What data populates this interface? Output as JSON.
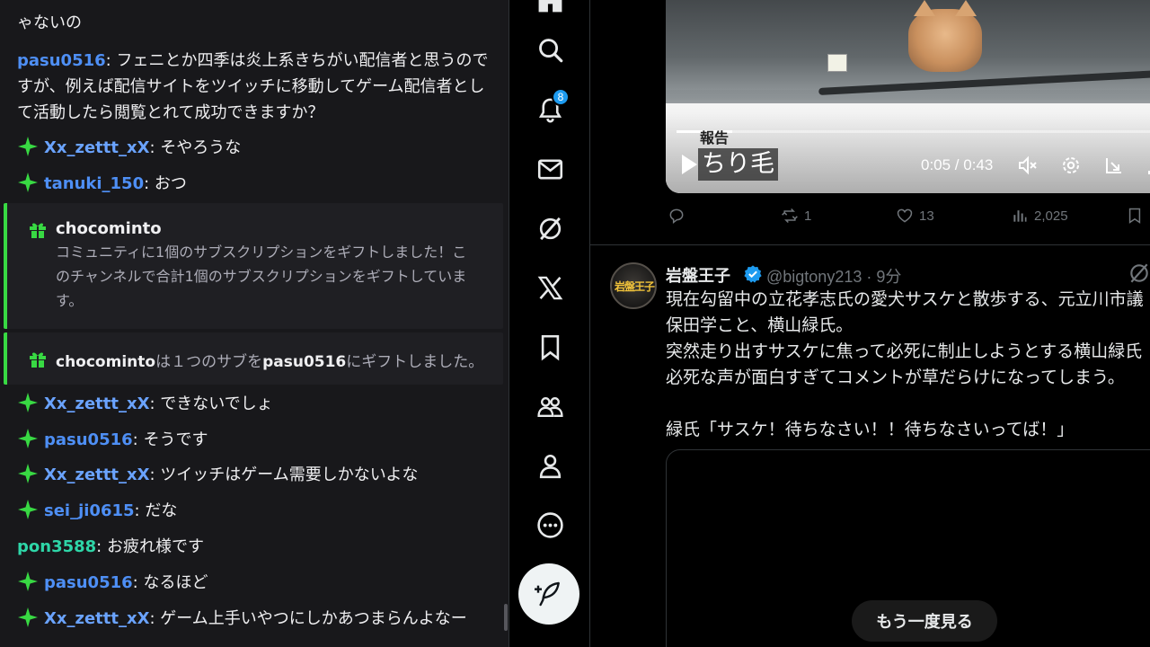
{
  "chat": {
    "partial_top": "ゃないの",
    "messages": [
      {
        "user": "pasu0516",
        "text": "フェニとか四季は炎上系きちがい配信者と思うのですが、例えば配信サイトをツイッチに移動してゲーム配信者として活動したら閲覧とれて成功できますか？",
        "badge": false,
        "color": "u-blue"
      },
      {
        "user": "Xx_zettt_xX",
        "text": "そやろうな",
        "badge": true,
        "color": "u-lblue"
      },
      {
        "user": "tanuki_150",
        "text": "おつ",
        "badge": true,
        "color": "u-blue"
      },
      {
        "user": "Xx_zettt_xX",
        "text": "できないでしょ",
        "badge": true,
        "color": "u-lblue"
      },
      {
        "user": "pasu0516",
        "text": "そうです",
        "badge": true,
        "color": "u-blue"
      },
      {
        "user": "Xx_zettt_xX",
        "text": "ツイッチはゲーム需要しかないよな",
        "badge": true,
        "color": "u-lblue"
      },
      {
        "user": "sei_ji0615",
        "text": "だな",
        "badge": true,
        "color": "u-blue"
      },
      {
        "user": "pon3588",
        "text": "お疲れ様です",
        "badge": false,
        "color": "u-teal"
      },
      {
        "user": "pasu0516",
        "text": "なるほど",
        "badge": true,
        "color": "u-blue"
      },
      {
        "user": "Xx_zettt_xX",
        "text": "ゲーム上手いやつにしかあつまらんよなー",
        "badge": true,
        "color": "u-lblue"
      }
    ],
    "gift1": {
      "user": "chocominto",
      "text": "コミュニティに1個のサブスクリプションをギフトしました！このチャンネルで合計1個のサブスクリプションをギフトしています。"
    },
    "gift2": {
      "user": "chocominto",
      "mid": "は１つのサブを",
      "recipient": "pasu0516",
      "end": "にギフトしました。"
    }
  },
  "nav": {
    "items": [
      "home-icon",
      "search-icon",
      "notifications-icon",
      "messages-icon",
      "grok-icon",
      "x-premium-icon",
      "bookmarks-icon",
      "communities-icon",
      "profile-icon",
      "more-icon"
    ],
    "notification_count": "8",
    "compose_icon": "compose-icon"
  },
  "video": {
    "report_label": "報告",
    "caption": "ちり毛",
    "time": "0:05 / 0:43",
    "progress": 0.116
  },
  "tweet1": {
    "replies": "",
    "reposts": "1",
    "likes": "13",
    "views": "2,025"
  },
  "tweet2": {
    "avatar_text": "岩盤王子",
    "name": "岩盤王子",
    "handle": "@bigtony213 · 9分",
    "body": "現在勾留中の立花孝志氏の愛犬サスケと散歩する、元立川市議\n保田学こと、横山緑氏。\n突然走り出すサスケに焦って必死に制止しようとする横山緑氏\n必死な声が面白すぎてコメントが草だらけになってしまう。\n\n緑氏「サスケ！待ちなさい！！待ちなさいってば！」",
    "replay_label": "もう一度見る"
  },
  "colors": {
    "accent": "#1d9bf0",
    "gift_green": "#38d943",
    "chat_bg": "#18181b"
  }
}
